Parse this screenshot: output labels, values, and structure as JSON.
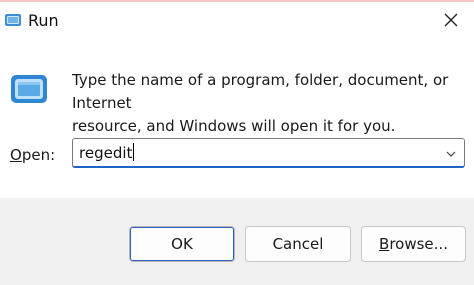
{
  "window": {
    "title": "Run",
    "title_icon": "run-icon",
    "close_icon": "close-icon"
  },
  "body": {
    "message_line1": "Type the name of a program, folder, document, or Internet",
    "message_line2": "resource, and Windows will open it for you.",
    "open_label_prefix": "O",
    "open_label_rest": "pen:",
    "input_value": "regedit",
    "dropdown_icon": "chevron-down-icon"
  },
  "buttons": {
    "ok": "OK",
    "cancel": "Cancel",
    "browse_prefix": "B",
    "browse_rest": "rowse..."
  },
  "colors": {
    "accent": "#1f63c7",
    "footer": "#f0f0f0"
  }
}
